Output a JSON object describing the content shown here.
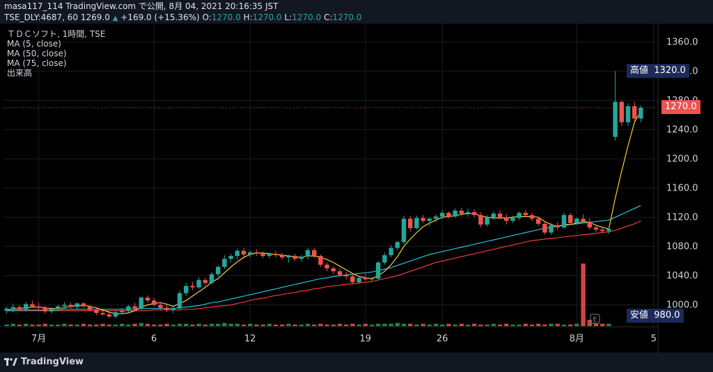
{
  "header": {
    "line1": "masa117_114 TradingView.com で公開, 8月 04, 2021 20:16:35 JST",
    "symbol": "TSE_DLY:4687, 60",
    "last": "1269.0",
    "change": "+169.0 (+15.36%)",
    "o_label": "O:",
    "o_value": "1270.0",
    "h_label": "H:",
    "h_value": "1270.0",
    "l_label": "L:",
    "l_value": "1270.0",
    "c_label": "C:",
    "c_value": "1270.0"
  },
  "legend": {
    "title": "ＴＤＣソフト, 1時間, TSE",
    "ma5": "MA (5, close)",
    "ma50": "MA (50, close)",
    "ma75": "MA (75, close)",
    "volume": "出来高"
  },
  "tags": {
    "high_label": "高値",
    "high_value": "1320.0",
    "last_value": "1270.0",
    "low_label": "安値",
    "low_value": "980.0"
  },
  "earnings_marker": "E",
  "footer": {
    "brand": "TradingView"
  },
  "colors": {
    "up": "#26a69a",
    "down": "#ef5350",
    "ma5": "#f5d033",
    "ma50": "#26c6da",
    "ma75": "#ef3b3b",
    "volume_up": "#2e9a4e",
    "volume_down": "#ef5350",
    "tag_bg": "#1c2a59",
    "last_tag": "#ef5350"
  },
  "chart_data": {
    "type": "candlestick",
    "title": "ＴＤＣソフト, 1時間, TSE",
    "y_ticks": [
      1360,
      1320,
      1280,
      1240,
      1200,
      1160,
      1120,
      1080,
      1040,
      1000
    ],
    "x_ticks": [
      "7月",
      "6",
      "12",
      "19",
      "26",
      "8月",
      "5"
    ],
    "ylim": [
      970,
      1385
    ],
    "x_tick_index": [
      5,
      23,
      38,
      56,
      68,
      89,
      101
    ],
    "candles": [
      {
        "o": 992,
        "h": 998,
        "l": 988,
        "c": 995
      },
      {
        "o": 995,
        "h": 1002,
        "l": 990,
        "c": 997
      },
      {
        "o": 997,
        "h": 1000,
        "l": 992,
        "c": 994
      },
      {
        "o": 994,
        "h": 1004,
        "l": 991,
        "c": 1001
      },
      {
        "o": 1001,
        "h": 1006,
        "l": 996,
        "c": 998
      },
      {
        "o": 998,
        "h": 1003,
        "l": 994,
        "c": 996
      },
      {
        "o": 996,
        "h": 999,
        "l": 988,
        "c": 991
      },
      {
        "o": 991,
        "h": 997,
        "l": 988,
        "c": 995
      },
      {
        "o": 995,
        "h": 1000,
        "l": 992,
        "c": 998
      },
      {
        "o": 998,
        "h": 1004,
        "l": 995,
        "c": 1000
      },
      {
        "o": 1000,
        "h": 1003,
        "l": 995,
        "c": 997
      },
      {
        "o": 997,
        "h": 1003,
        "l": 994,
        "c": 1002
      },
      {
        "o": 1002,
        "h": 1004,
        "l": 996,
        "c": 998
      },
      {
        "o": 998,
        "h": 1000,
        "l": 991,
        "c": 993
      },
      {
        "o": 993,
        "h": 996,
        "l": 986,
        "c": 989
      },
      {
        "o": 989,
        "h": 993,
        "l": 985,
        "c": 987
      },
      {
        "o": 987,
        "h": 990,
        "l": 982,
        "c": 984
      },
      {
        "o": 984,
        "h": 992,
        "l": 982,
        "c": 990
      },
      {
        "o": 990,
        "h": 996,
        "l": 987,
        "c": 992
      },
      {
        "o": 992,
        "h": 1000,
        "l": 990,
        "c": 998
      },
      {
        "o": 998,
        "h": 1003,
        "l": 993,
        "c": 995
      },
      {
        "o": 995,
        "h": 1012,
        "l": 993,
        "c": 1010
      },
      {
        "o": 1010,
        "h": 1013,
        "l": 1003,
        "c": 1006
      },
      {
        "o": 1006,
        "h": 1010,
        "l": 998,
        "c": 1000
      },
      {
        "o": 1000,
        "h": 1004,
        "l": 993,
        "c": 996
      },
      {
        "o": 996,
        "h": 1000,
        "l": 990,
        "c": 993
      },
      {
        "o": 993,
        "h": 997,
        "l": 989,
        "c": 995
      },
      {
        "o": 995,
        "h": 1020,
        "l": 993,
        "c": 1016
      },
      {
        "o": 1016,
        "h": 1030,
        "l": 1012,
        "c": 1026
      },
      {
        "o": 1026,
        "h": 1032,
        "l": 1020,
        "c": 1024
      },
      {
        "o": 1024,
        "h": 1038,
        "l": 1022,
        "c": 1034
      },
      {
        "o": 1034,
        "h": 1037,
        "l": 1026,
        "c": 1030
      },
      {
        "o": 1030,
        "h": 1045,
        "l": 1028,
        "c": 1042
      },
      {
        "o": 1042,
        "h": 1055,
        "l": 1038,
        "c": 1052
      },
      {
        "o": 1052,
        "h": 1068,
        "l": 1049,
        "c": 1063
      },
      {
        "o": 1063,
        "h": 1070,
        "l": 1058,
        "c": 1067
      },
      {
        "o": 1067,
        "h": 1077,
        "l": 1062,
        "c": 1074
      },
      {
        "o": 1074,
        "h": 1078,
        "l": 1066,
        "c": 1069
      },
      {
        "o": 1069,
        "h": 1074,
        "l": 1065,
        "c": 1072
      },
      {
        "o": 1072,
        "h": 1076,
        "l": 1067,
        "c": 1070
      },
      {
        "o": 1070,
        "h": 1073,
        "l": 1064,
        "c": 1067
      },
      {
        "o": 1067,
        "h": 1072,
        "l": 1064,
        "c": 1070
      },
      {
        "o": 1070,
        "h": 1074,
        "l": 1065,
        "c": 1068
      },
      {
        "o": 1068,
        "h": 1071,
        "l": 1062,
        "c": 1065
      },
      {
        "o": 1065,
        "h": 1069,
        "l": 1058,
        "c": 1067
      },
      {
        "o": 1067,
        "h": 1070,
        "l": 1060,
        "c": 1063
      },
      {
        "o": 1063,
        "h": 1068,
        "l": 1059,
        "c": 1066
      },
      {
        "o": 1066,
        "h": 1078,
        "l": 1062,
        "c": 1075
      },
      {
        "o": 1075,
        "h": 1078,
        "l": 1064,
        "c": 1067
      },
      {
        "o": 1067,
        "h": 1069,
        "l": 1052,
        "c": 1055
      },
      {
        "o": 1055,
        "h": 1058,
        "l": 1046,
        "c": 1050
      },
      {
        "o": 1050,
        "h": 1053,
        "l": 1042,
        "c": 1046
      },
      {
        "o": 1046,
        "h": 1050,
        "l": 1038,
        "c": 1041
      },
      {
        "o": 1041,
        "h": 1045,
        "l": 1035,
        "c": 1039
      },
      {
        "o": 1039,
        "h": 1043,
        "l": 1028,
        "c": 1031
      },
      {
        "o": 1031,
        "h": 1040,
        "l": 1029,
        "c": 1037
      },
      {
        "o": 1037,
        "h": 1042,
        "l": 1033,
        "c": 1035
      },
      {
        "o": 1035,
        "h": 1038,
        "l": 1032,
        "c": 1036
      },
      {
        "o": 1036,
        "h": 1060,
        "l": 1034,
        "c": 1058
      },
      {
        "o": 1058,
        "h": 1072,
        "l": 1055,
        "c": 1068
      },
      {
        "o": 1068,
        "h": 1082,
        "l": 1065,
        "c": 1078
      },
      {
        "o": 1078,
        "h": 1088,
        "l": 1075,
        "c": 1086
      },
      {
        "o": 1086,
        "h": 1122,
        "l": 1083,
        "c": 1118
      },
      {
        "o": 1118,
        "h": 1122,
        "l": 1100,
        "c": 1105
      },
      {
        "o": 1105,
        "h": 1122,
        "l": 1103,
        "c": 1119
      },
      {
        "o": 1119,
        "h": 1123,
        "l": 1112,
        "c": 1115
      },
      {
        "o": 1115,
        "h": 1120,
        "l": 1108,
        "c": 1118
      },
      {
        "o": 1118,
        "h": 1124,
        "l": 1113,
        "c": 1121
      },
      {
        "o": 1121,
        "h": 1130,
        "l": 1117,
        "c": 1126
      },
      {
        "o": 1126,
        "h": 1128,
        "l": 1118,
        "c": 1121
      },
      {
        "o": 1121,
        "h": 1132,
        "l": 1119,
        "c": 1129
      },
      {
        "o": 1129,
        "h": 1133,
        "l": 1122,
        "c": 1125
      },
      {
        "o": 1125,
        "h": 1132,
        "l": 1121,
        "c": 1127
      },
      {
        "o": 1127,
        "h": 1131,
        "l": 1120,
        "c": 1123
      },
      {
        "o": 1123,
        "h": 1127,
        "l": 1106,
        "c": 1110
      },
      {
        "o": 1110,
        "h": 1123,
        "l": 1107,
        "c": 1120
      },
      {
        "o": 1120,
        "h": 1128,
        "l": 1116,
        "c": 1125
      },
      {
        "o": 1125,
        "h": 1129,
        "l": 1117,
        "c": 1120
      },
      {
        "o": 1120,
        "h": 1124,
        "l": 1110,
        "c": 1115
      },
      {
        "o": 1115,
        "h": 1122,
        "l": 1112,
        "c": 1119
      },
      {
        "o": 1119,
        "h": 1128,
        "l": 1116,
        "c": 1126
      },
      {
        "o": 1126,
        "h": 1130,
        "l": 1120,
        "c": 1123
      },
      {
        "o": 1123,
        "h": 1126,
        "l": 1115,
        "c": 1118
      },
      {
        "o": 1118,
        "h": 1121,
        "l": 1108,
        "c": 1111
      },
      {
        "o": 1111,
        "h": 1114,
        "l": 1096,
        "c": 1099
      },
      {
        "o": 1099,
        "h": 1112,
        "l": 1096,
        "c": 1109
      },
      {
        "o": 1109,
        "h": 1113,
        "l": 1102,
        "c": 1106
      },
      {
        "o": 1106,
        "h": 1126,
        "l": 1104,
        "c": 1123
      },
      {
        "o": 1123,
        "h": 1126,
        "l": 1109,
        "c": 1112
      },
      {
        "o": 1112,
        "h": 1120,
        "l": 1110,
        "c": 1118
      },
      {
        "o": 1118,
        "h": 1124,
        "l": 1112,
        "c": 1114
      },
      {
        "o": 1114,
        "h": 1119,
        "l": 1103,
        "c": 1106
      },
      {
        "o": 1106,
        "h": 1110,
        "l": 1100,
        "c": 1103
      },
      {
        "o": 1103,
        "h": 1108,
        "l": 1098,
        "c": 1101
      },
      {
        "o": 1101,
        "h": 1106,
        "l": 1097,
        "c": 1104
      },
      {
        "o": 1230,
        "h": 1320,
        "l": 1225,
        "c": 1278
      },
      {
        "o": 1278,
        "h": 1280,
        "l": 1245,
        "c": 1250
      },
      {
        "o": 1250,
        "h": 1276,
        "l": 1245,
        "c": 1272
      },
      {
        "o": 1272,
        "h": 1278,
        "l": 1250,
        "c": 1255
      },
      {
        "o": 1255,
        "h": 1273,
        "l": 1250,
        "c": 1270
      }
    ],
    "volume": [
      2,
      3,
      2,
      3,
      2,
      2,
      3,
      2,
      2,
      3,
      2,
      2,
      3,
      2,
      2,
      3,
      2,
      2,
      3,
      2,
      3,
      4,
      3,
      2,
      2,
      3,
      2,
      3,
      3,
      2,
      3,
      2,
      3,
      3,
      4,
      3,
      3,
      2,
      3,
      2,
      2,
      3,
      2,
      2,
      3,
      2,
      2,
      3,
      2,
      3,
      2,
      2,
      3,
      2,
      3,
      2,
      3,
      2,
      3,
      3,
      3,
      4,
      3,
      3,
      2,
      3,
      2,
      3,
      2,
      3,
      2,
      3,
      2,
      3,
      2,
      2,
      3,
      2,
      3,
      2,
      2,
      3,
      2,
      3,
      2,
      3,
      3,
      2,
      2,
      3,
      80,
      8,
      4,
      3,
      3
    ],
    "ma5": [
      993,
      994,
      995,
      996,
      997,
      997,
      996,
      995,
      995,
      996,
      998,
      999,
      999,
      998,
      996,
      993,
      990,
      988,
      988,
      989,
      992,
      997,
      1000,
      1002,
      1003,
      1001,
      998,
      1002,
      1006,
      1012,
      1018,
      1024,
      1031,
      1036,
      1044,
      1052,
      1059,
      1065,
      1069,
      1071,
      1071,
      1070,
      1069,
      1068,
      1067,
      1066,
      1065,
      1067,
      1067,
      1065,
      1062,
      1058,
      1053,
      1048,
      1043,
      1039,
      1037,
      1036,
      1040,
      1046,
      1055,
      1066,
      1080,
      1090,
      1099,
      1107,
      1112,
      1116,
      1120,
      1121,
      1122,
      1124,
      1125,
      1125,
      1122,
      1120,
      1119,
      1119,
      1119,
      1120,
      1121,
      1121,
      1121,
      1120,
      1114,
      1110,
      1107,
      1110,
      1110,
      1112,
      1114,
      1113,
      1109,
      1106,
      1104,
      1146,
      1183,
      1218,
      1250,
      1265
    ],
    "ma50": [
      992,
      992,
      993,
      993,
      993,
      993,
      993,
      993,
      993,
      994,
      994,
      994,
      994,
      994,
      994,
      994,
      994,
      994,
      994,
      994,
      994,
      995,
      995,
      995,
      995,
      995,
      995,
      996,
      997,
      998,
      999,
      1001,
      1003,
      1004,
      1006,
      1008,
      1010,
      1012,
      1014,
      1016,
      1018,
      1020,
      1022,
      1024,
      1026,
      1028,
      1030,
      1032,
      1034,
      1036,
      1037,
      1039,
      1040,
      1041,
      1042,
      1043,
      1044,
      1045,
      1047,
      1049,
      1051,
      1054,
      1057,
      1060,
      1063,
      1066,
      1069,
      1071,
      1073,
      1075,
      1077,
      1079,
      1081,
      1083,
      1085,
      1087,
      1089,
      1091,
      1093,
      1095,
      1097,
      1099,
      1101,
      1103,
      1105,
      1106,
      1108,
      1109,
      1110,
      1111,
      1112,
      1113,
      1114,
      1115,
      1116,
      1120,
      1124,
      1128,
      1132,
      1136
    ],
    "ma75": [
      992,
      992,
      992,
      992,
      992,
      992,
      992,
      992,
      992,
      992,
      992,
      992,
      992,
      992,
      992,
      992,
      992,
      992,
      992,
      992,
      992,
      992,
      992,
      993,
      993,
      993,
      993,
      993,
      994,
      994,
      995,
      996,
      997,
      998,
      999,
      1000,
      1002,
      1004,
      1006,
      1008,
      1009,
      1011,
      1013,
      1014,
      1016,
      1017,
      1019,
      1020,
      1022,
      1023,
      1025,
      1026,
      1027,
      1028,
      1029,
      1030,
      1031,
      1032,
      1034,
      1036,
      1038,
      1040,
      1043,
      1046,
      1049,
      1052,
      1055,
      1058,
      1060,
      1062,
      1064,
      1066,
      1068,
      1070,
      1072,
      1074,
      1076,
      1078,
      1080,
      1082,
      1084,
      1086,
      1088,
      1089,
      1090,
      1091,
      1092,
      1093,
      1094,
      1095,
      1096,
      1097,
      1098,
      1099,
      1100,
      1102,
      1105,
      1108,
      1111,
      1115
    ]
  }
}
